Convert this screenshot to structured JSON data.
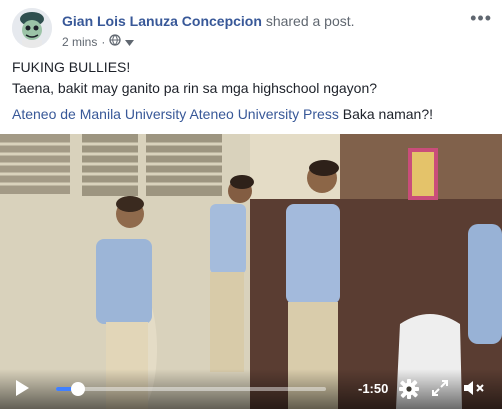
{
  "post": {
    "author": "Gian Lois Lanuza Concepcion",
    "action": "shared a post.",
    "time": "2 mins",
    "time_sep": "·",
    "privacy_icon": "globe-icon",
    "line1": "FUKING BULLIES!",
    "line2": "Taena, bakit may ganito pa rin sa mga highschool ngayon?",
    "link1": "Ateneo de Manila University",
    "link2": "Ateneo University Press",
    "link_suffix": "Baka naman?!"
  },
  "video": {
    "remaining_time": "-1:50",
    "progress": 0.08,
    "colors": {
      "accent": "#4080ff",
      "author": "#385898"
    }
  }
}
